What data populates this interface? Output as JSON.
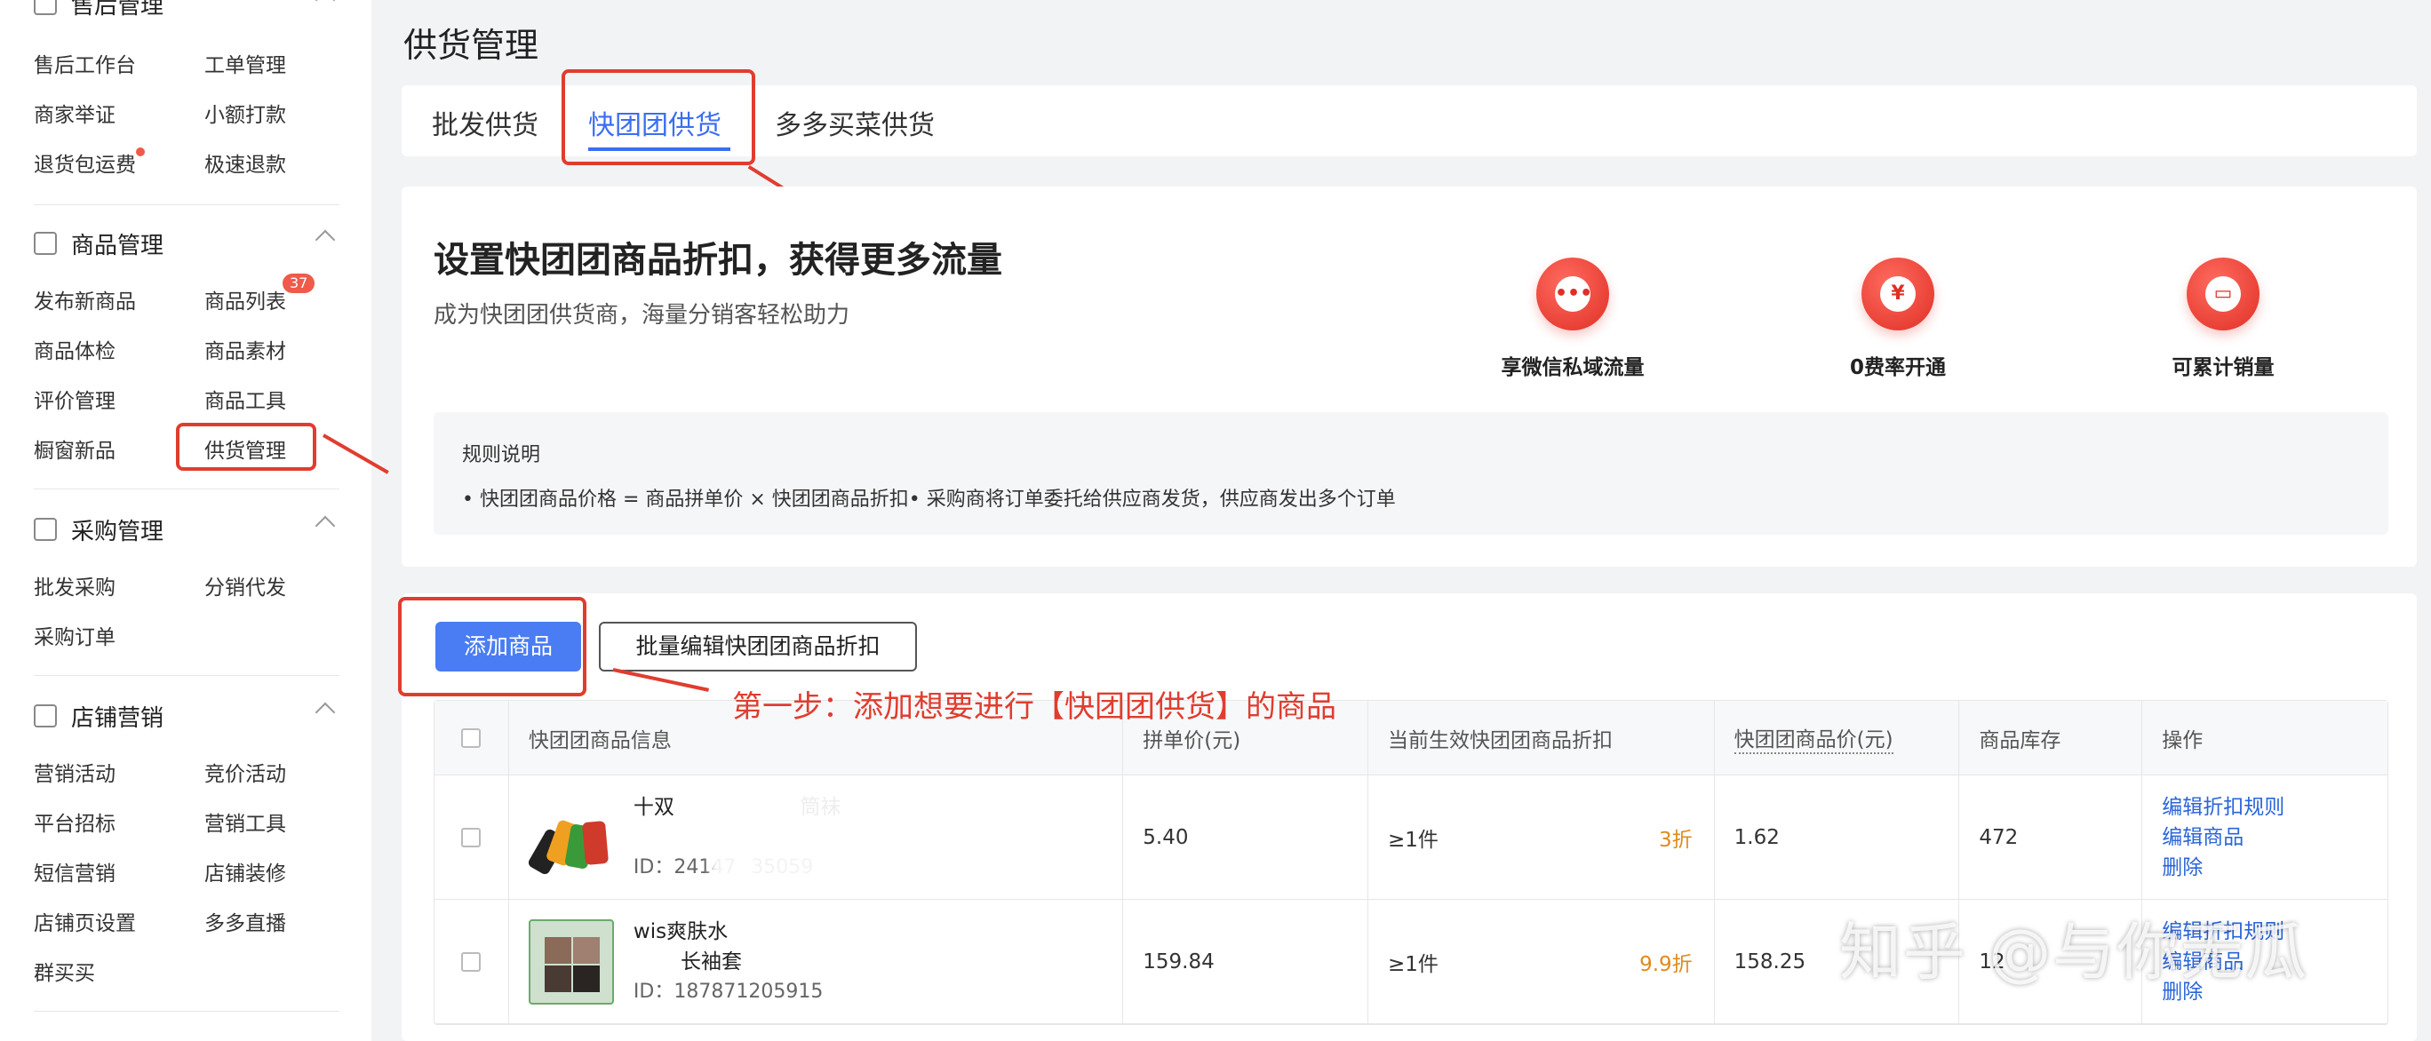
{
  "sidebar": {
    "groups": [
      {
        "title": "售后管理",
        "items": [
          "售后工作台",
          "工单管理",
          "商家举证",
          "小额打款",
          "退货包运费",
          "极速退款"
        ]
      },
      {
        "title": "商品管理",
        "items": [
          "发布新商品",
          "商品列表",
          "商品体检",
          "商品素材",
          "评价管理",
          "商品工具",
          "橱窗新品",
          "供货管理"
        ],
        "badge": "37"
      },
      {
        "title": "采购管理",
        "items": [
          "批发采购",
          "分销代发",
          "采购订单"
        ]
      },
      {
        "title": "店铺营销",
        "items": [
          "营销活动",
          "竞价活动",
          "平台招标",
          "营销工具",
          "短信营销",
          "店铺装修",
          "店铺页设置",
          "多多直播",
          "群买买"
        ]
      }
    ]
  },
  "page": {
    "title": "供货管理"
  },
  "tabs": [
    "批发供货",
    "快团团供货",
    "多多买菜供货"
  ],
  "promo": {
    "title": "设置快团团商品折扣，获得更多流量",
    "subtitle": "成为快团团供货商，海量分销客轻松助力",
    "features": [
      {
        "label": "享微信私域流量",
        "icon": "chat-icon",
        "glyph": "•••"
      },
      {
        "label": "0费率开通",
        "icon": "yuan-icon",
        "glyph": "¥"
      },
      {
        "label": "可累计销量",
        "icon": "monitor-chart-icon",
        "glyph": "▭"
      }
    ],
    "rules_title": "规则说明",
    "rules_text": "• 快团团商品价格 = 商品拼单价 × 快团团商品折扣• 采购商将订单委托给供应商发货，供应商发出多个订单"
  },
  "actions": {
    "add": "添加商品",
    "batch_edit": "批量编辑快团团商品折扣"
  },
  "annotation": "第一步：添加想要进行【快团团供货】的商品",
  "table": {
    "columns": [
      "快团团商品信息",
      "拼单价(元)",
      "当前生效快团团商品折扣",
      "快团团商品价(元)",
      "商品库存",
      "操作"
    ],
    "rows": [
      {
        "name": "十双",
        "name_tail": "筒袜",
        "id": "ID：24147",
        "id_tail": "35059",
        "price": "5.40",
        "cond": "≥1件",
        "discount": "3折",
        "kt_price": "1.62",
        "stock": "472",
        "ops": [
          "编辑折扣规则",
          "编辑商品",
          "删除"
        ]
      },
      {
        "name": "wis爽肤水",
        "name_tail": "长袖套",
        "id": "ID：18787",
        "id_tail": "1205915",
        "price": "159.84",
        "cond": "≥1件",
        "discount": "9.9折",
        "kt_price": "158.25",
        "stock": "12",
        "ops": [
          "编辑折扣规则",
          "编辑商品",
          "删除"
        ]
      }
    ]
  },
  "watermark": "知乎 @与你无瓜",
  "colors": {
    "primary": "#4a7cf3",
    "highlight": "#e03d2f",
    "discount": "#e08a1c",
    "link": "#2a65d8"
  }
}
